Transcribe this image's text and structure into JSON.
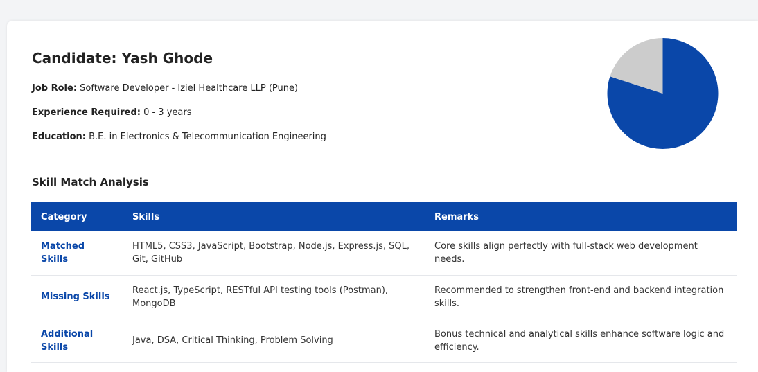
{
  "candidate": {
    "title": "Candidate: Yash Ghode",
    "job_role_label": "Job Role:",
    "job_role_value": " Software Developer - Iziel Healthcare LLP (Pune)",
    "experience_label": "Experience Required:",
    "experience_value": " 0 - 3 years",
    "education_label": "Education:",
    "education_value": " B.E. in Electronics & Telecommunication Engineering"
  },
  "chart_data": {
    "type": "pie",
    "values": [
      80,
      20
    ],
    "colors": [
      "#0a47a9",
      "#cccccc"
    ]
  },
  "section": {
    "title": "Skill Match Analysis"
  },
  "table": {
    "headers": [
      "Category",
      "Skills",
      "Remarks"
    ],
    "rows": [
      {
        "category": "Matched Skills",
        "skills": "HTML5, CSS3, JavaScript, Bootstrap, Node.js, Express.js, SQL, Git, GitHub",
        "remarks": "Core skills align perfectly with full-stack web development needs."
      },
      {
        "category": "Missing Skills",
        "skills": "React.js, TypeScript, RESTful API testing tools (Postman), MongoDB",
        "remarks": "Recommended to strengthen front-end and backend integration skills."
      },
      {
        "category": "Additional Skills",
        "skills": "Java, DSA, Critical Thinking, Problem Solving",
        "remarks": "Bonus technical and analytical skills enhance software logic and efficiency."
      }
    ]
  }
}
